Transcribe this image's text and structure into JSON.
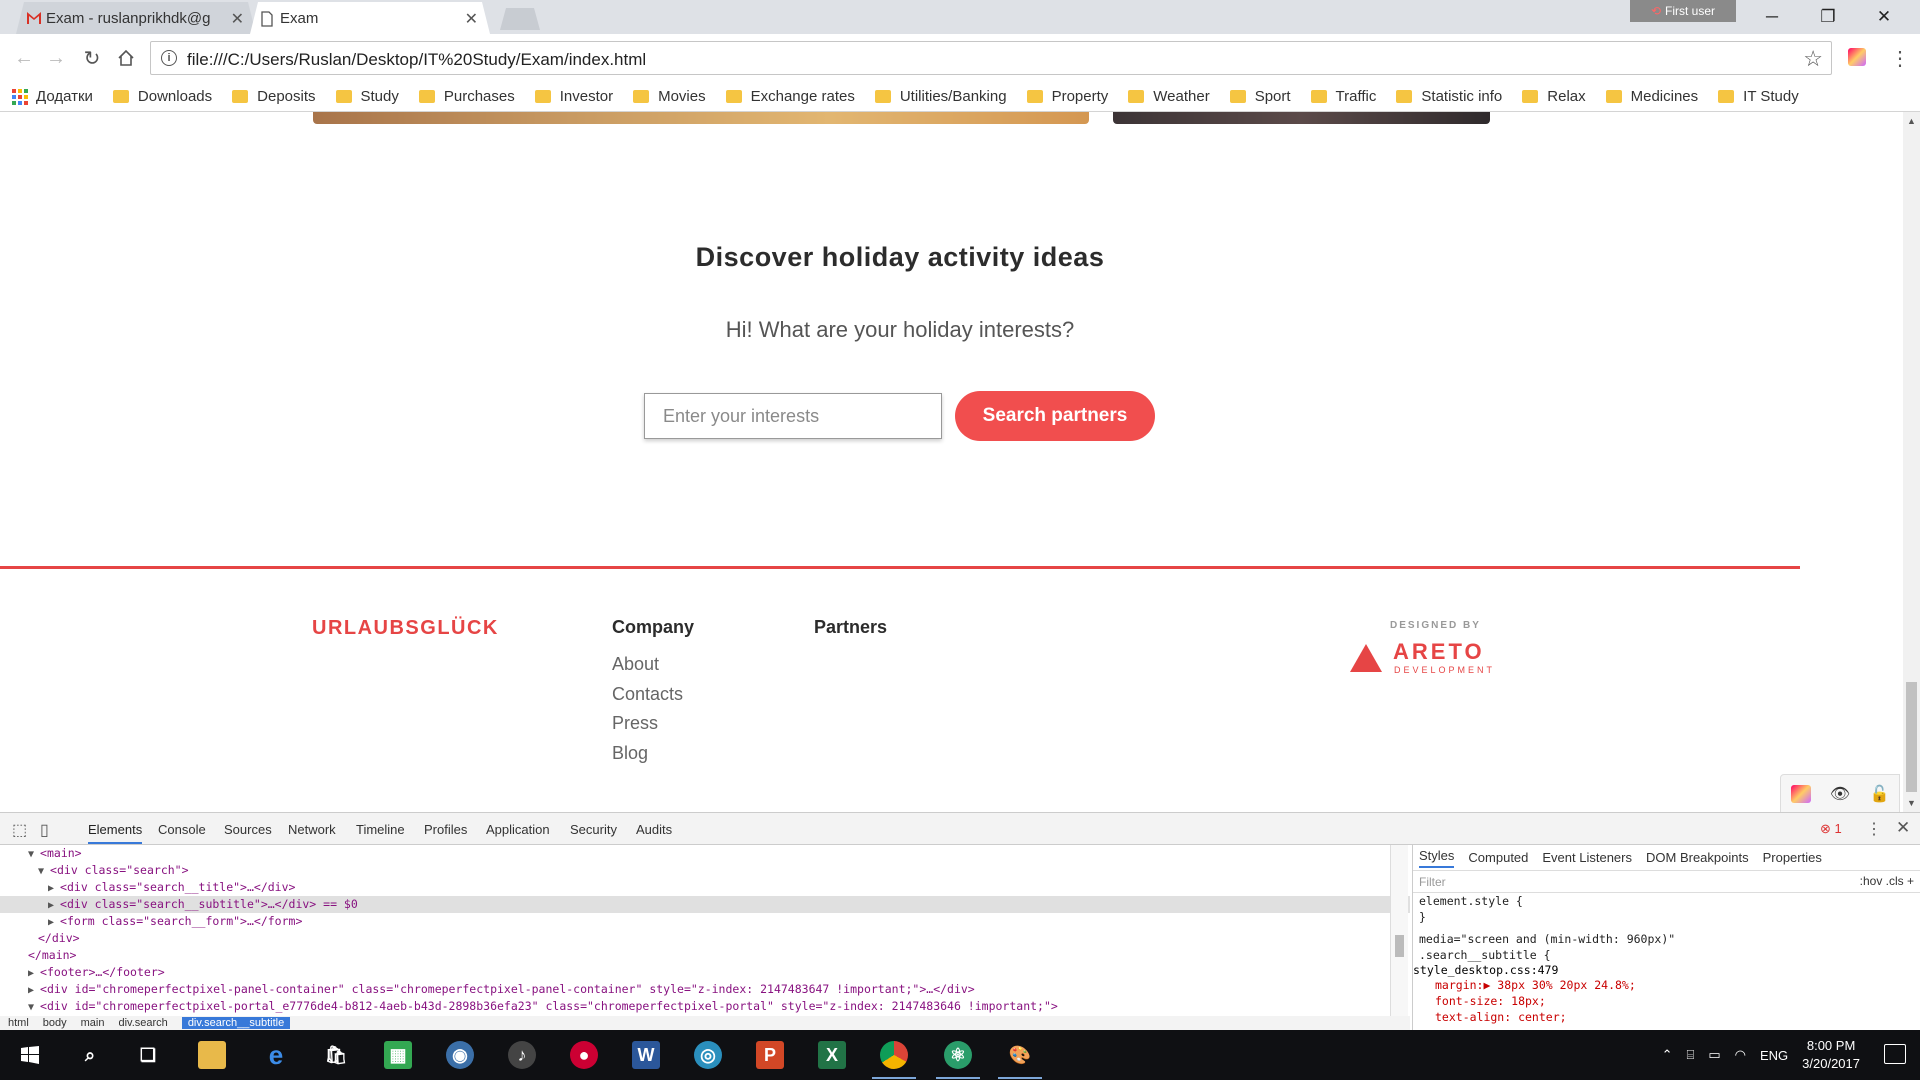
{
  "browser": {
    "tabs": [
      {
        "label": "Exam - ruslanprikhdk@g"
      },
      {
        "label": "Exam"
      }
    ],
    "profile_label": "First user",
    "url": "file:///C:/Users/Ruslan/Desktop/IT%20Study/Exam/index.html",
    "bookmarks": [
      "Додатки",
      "Downloads",
      "Deposits",
      "Study",
      "Purchases",
      "Investor",
      "Movies",
      "Exchange rates",
      "Utilities/Banking",
      "Property",
      "Weather",
      "Sport",
      "Traffic",
      "Statistic info",
      "Relax",
      "Medicines",
      "IT Study"
    ]
  },
  "page": {
    "search_title": "Discover holiday activity ideas",
    "search_subtitle": "Hi! What are your holiday interests?",
    "search_placeholder": "Enter your interests",
    "search_button": "Search partners",
    "footer": {
      "logo": "URLAUBSGLÜCK",
      "company_title": "Company",
      "company_links": [
        "About",
        "Contacts",
        "Press",
        "Blog"
      ],
      "partners_title": "Partners",
      "designed_by": "DESIGNED BY",
      "designer_name": "ARETO",
      "designer_sub": "DEVELOPMENT"
    }
  },
  "devtools": {
    "tabs": [
      "Elements",
      "Console",
      "Sources",
      "Network",
      "Timeline",
      "Profiles",
      "Application",
      "Security",
      "Audits"
    ],
    "error_count": "1",
    "dom_lines": [
      "<main>",
      "<div class=\"search\">",
      "<div class=\"search__title\">…</div>",
      "<div class=\"search__subtitle\">…</div> == $0",
      "<form class=\"search__form\">…</form>",
      "</div>",
      "</main>",
      "<footer>…</footer>",
      "<div id=\"chromeperfectpixel-panel-container\" class=\"chromeperfectpixel-panel-container\" style=\"z-index: 2147483647 !important;\">…</div>",
      "<div id=\"chromeperfectpixel-portal_e7776de4-b812-4aeb-b43d-2898b36efa23\" class=\"chromeperfectpixel-portal\" style=\"z-index: 2147483646 !important;\">"
    ],
    "breadcrumbs": [
      "html",
      "body",
      "main",
      "div.search",
      "div.search__subtitle"
    ],
    "styles_tabs": [
      "Styles",
      "Computed",
      "Event Listeners",
      "DOM Breakpoints",
      "Properties"
    ],
    "filter_placeholder": "Filter",
    "filter_right": ":hov  .cls  +",
    "css_lines": [
      "element.style {",
      "}",
      "media=\"screen and (min-width: 960px)\"",
      ".search__subtitle {",
      "margin:▶ 38px 30% 20px 24.8%;",
      "font-size: 18px;",
      "text-align: center;"
    ],
    "css_source": "style_desktop.css:479"
  },
  "taskbar": {
    "language": "ENG",
    "time": "8:00 PM",
    "date": "3/20/2017"
  },
  "colors": {
    "accent": "#f14e4e",
    "footer_red": "#e64545"
  }
}
